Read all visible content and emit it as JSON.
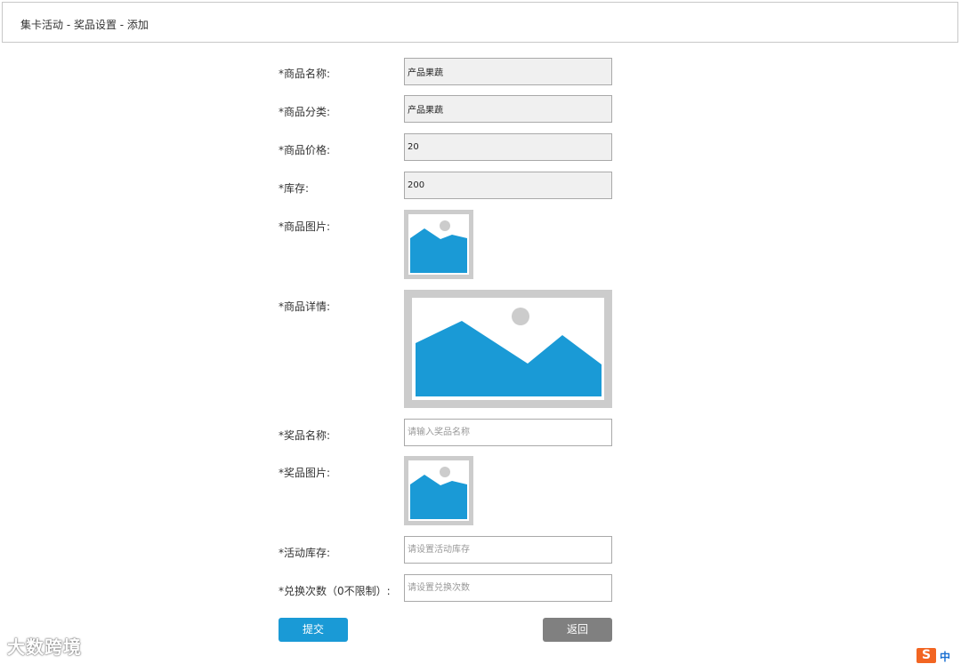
{
  "breadcrumb": "集卡活动 - 奖品设置 - 添加",
  "form": {
    "product_name": {
      "label": "*商品名称:",
      "value": "产品果蔬"
    },
    "product_category": {
      "label": "*商品分类:",
      "value": "产品果蔬"
    },
    "product_price": {
      "label": "*商品价格:",
      "value": "20"
    },
    "stock": {
      "label": "*库存:",
      "value": "200"
    },
    "product_image": {
      "label": "*商品图片:"
    },
    "product_detail": {
      "label": "*商品详情:"
    },
    "prize_name": {
      "label": "*奖品名称:",
      "placeholder": "请输入奖品名称"
    },
    "prize_image": {
      "label": "*奖品图片:"
    },
    "activity_stock": {
      "label": "*活动库存:",
      "placeholder": "请设置活动库存"
    },
    "redeem_count": {
      "label": "*兑换次数（0不限制）:",
      "placeholder": "请设置兑换次数"
    }
  },
  "buttons": {
    "submit": "提交",
    "back": "返回"
  },
  "watermark": "大数跨境",
  "ime": {
    "logo": "S",
    "mode": "中"
  },
  "colors": {
    "accent": "#1a9ad6",
    "back_button": "#808080",
    "placeholder_bg": "#cccccc",
    "readonly_bg": "#f0f0f0"
  }
}
